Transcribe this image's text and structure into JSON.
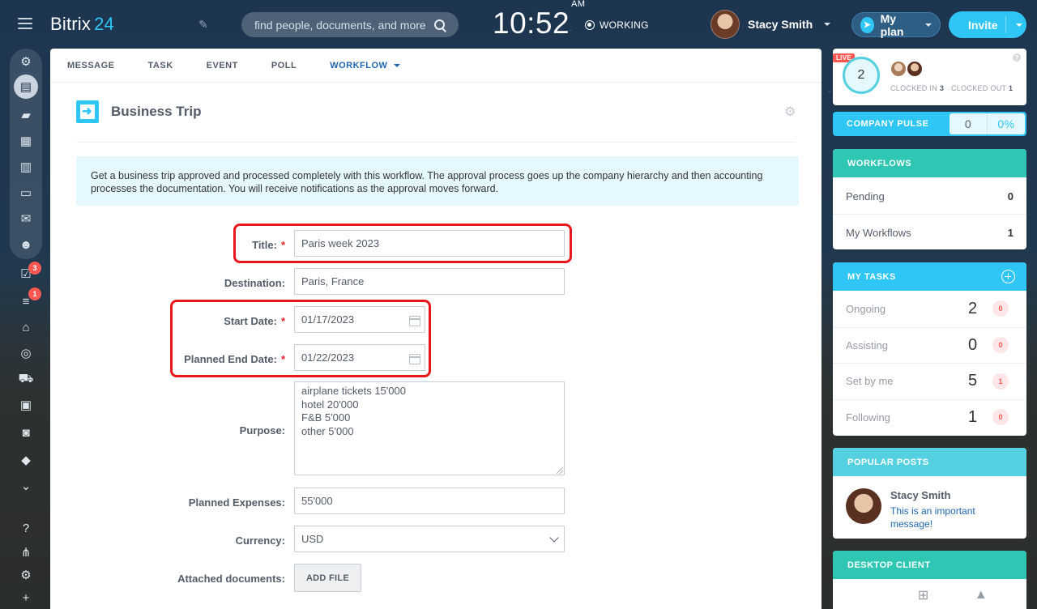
{
  "app": {
    "logo_text": "Bitrix",
    "logo_num": "24"
  },
  "header": {
    "search_placeholder": "find people, documents, and more",
    "clock": "10:52",
    "clock_ampm": "AM",
    "status": "WORKING",
    "user_name": "Stacy Smith",
    "plan_label": "My plan",
    "invite_label": "Invite"
  },
  "sidebar": {
    "badges": {
      "tasks": "3",
      "feed": "1"
    }
  },
  "tabs": [
    {
      "label": "MESSAGE"
    },
    {
      "label": "TASK"
    },
    {
      "label": "EVENT"
    },
    {
      "label": "POLL"
    },
    {
      "label": "WORKFLOW"
    }
  ],
  "workflow": {
    "title": "Business Trip",
    "description": "Get a business trip approved and processed completely with this workflow. The approval process goes up the company hierarchy and then accounting processes the documentation. You will receive notifications as the approval moves forward.",
    "fields": {
      "title_label": "Title:",
      "title_value": "Paris week 2023",
      "destination_label": "Destination:",
      "destination_value": "Paris, France",
      "start_label": "Start Date:",
      "start_value": "01/17/2023",
      "end_label": "Planned End Date:",
      "end_value": "01/22/2023",
      "purpose_label": "Purpose:",
      "purpose_value": "airplane tickets 15'000\nhotel 20'000\nF&B 5'000\nother 5'000",
      "expenses_label": "Planned Expenses:",
      "expenses_value": "55'000",
      "currency_label": "Currency:",
      "currency_value": "USD",
      "docs_label": "Attached documents:",
      "add_file_label": "ADD FILE",
      "required_mark": "*"
    }
  },
  "right": {
    "timeman": {
      "live": "LIVE",
      "count": "2",
      "clocked_in_label": "CLOCKED IN",
      "clocked_in": "3",
      "clocked_out_label": "CLOCKED OUT",
      "clocked_out": "1",
      "help": "?"
    },
    "pulse": {
      "label": "COMPANY PULSE",
      "value": "0",
      "percent": "0%"
    },
    "workflows": {
      "title": "WORKFLOWS",
      "rows": [
        {
          "label": "Pending",
          "value": "0"
        },
        {
          "label": "My Workflows",
          "value": "1"
        }
      ]
    },
    "tasks": {
      "title": "MY TASKS",
      "rows": [
        {
          "label": "Ongoing",
          "value": "2",
          "badge": "0"
        },
        {
          "label": "Assisting",
          "value": "0",
          "badge": "0"
        },
        {
          "label": "Set by me",
          "value": "5",
          "badge": "1"
        },
        {
          "label": "Following",
          "value": "1",
          "badge": "0"
        }
      ]
    },
    "popular": {
      "title": "POPULAR POSTS",
      "author": "Stacy Smith",
      "message": "This is an important message!"
    },
    "desktop": {
      "title": "DESKTOP CLIENT"
    }
  },
  "colors": {
    "accent": "#2fc6f6",
    "link": "#2067b0",
    "highlight": "#e8171c",
    "teal_header": "#2fc6b4"
  }
}
